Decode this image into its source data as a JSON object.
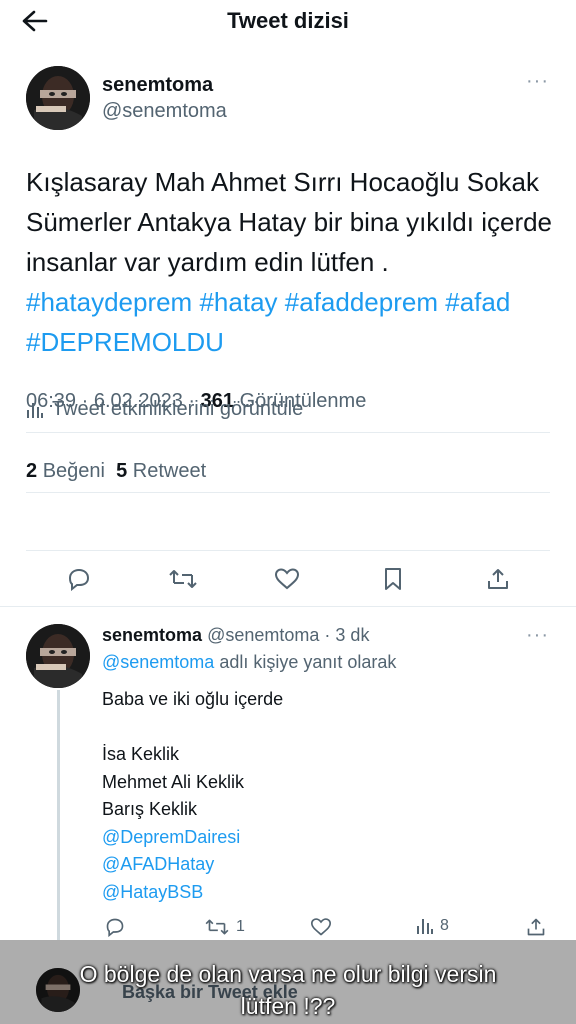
{
  "header": {
    "title": "Tweet dizisi",
    "back_icon": "arrow-left-icon"
  },
  "main_tweet": {
    "display_name": "senemtoma",
    "handle": "@senemtoma",
    "more": "···",
    "text_plain": "Kışlasaray  Mah Ahmet Sırrı Hocaoğlu Sokak Sümerler Antakya Hatay bir bina yıkıldı içerde insanlar var yardım edin lütfen .",
    "hashtags": [
      "#hataydeprem",
      "#hatay",
      "#afaddeprem",
      "#afad",
      "#DEPREMOLDU"
    ],
    "time": "06:39",
    "sep1": "·",
    "date": "6.02.2023",
    "sep2": "·",
    "views_count": "361",
    "views_label": "Görüntülenme",
    "analytics_label": "Tweet etkinliklerini görüntüle",
    "likes_count": "2",
    "likes_label": "Beğeni",
    "retweets_count": "5",
    "retweets_label": "Retweet"
  },
  "reply_tweet": {
    "display_name": "senemtoma",
    "handle": "@senemtoma",
    "sep": "·",
    "age": "3 dk",
    "more": "···",
    "reply_to_mention": "@senemtoma",
    "reply_to_suffix": "adlı kişiye yanıt olarak",
    "lines": [
      "Baba ve iki oğlu içerde",
      "",
      "İsa Keklik",
      "Mehmet Ali Keklik",
      "Barış Keklik"
    ],
    "mentions": [
      "@DepremDairesi",
      "@AFADHatay",
      "@HatayBSB"
    ],
    "retweet_count": "1",
    "view_count": "8"
  },
  "compose": {
    "placeholder": "Başka bir Tweet ekle"
  },
  "overlay_caption": {
    "line1": "O bölge de olan varsa ne olur bilgi versin",
    "line2": "lütfen !??"
  },
  "colors": {
    "accent": "#1d9bf0",
    "text": "#0f1419",
    "secondary": "#536471",
    "divider": "#e6ecf0"
  }
}
